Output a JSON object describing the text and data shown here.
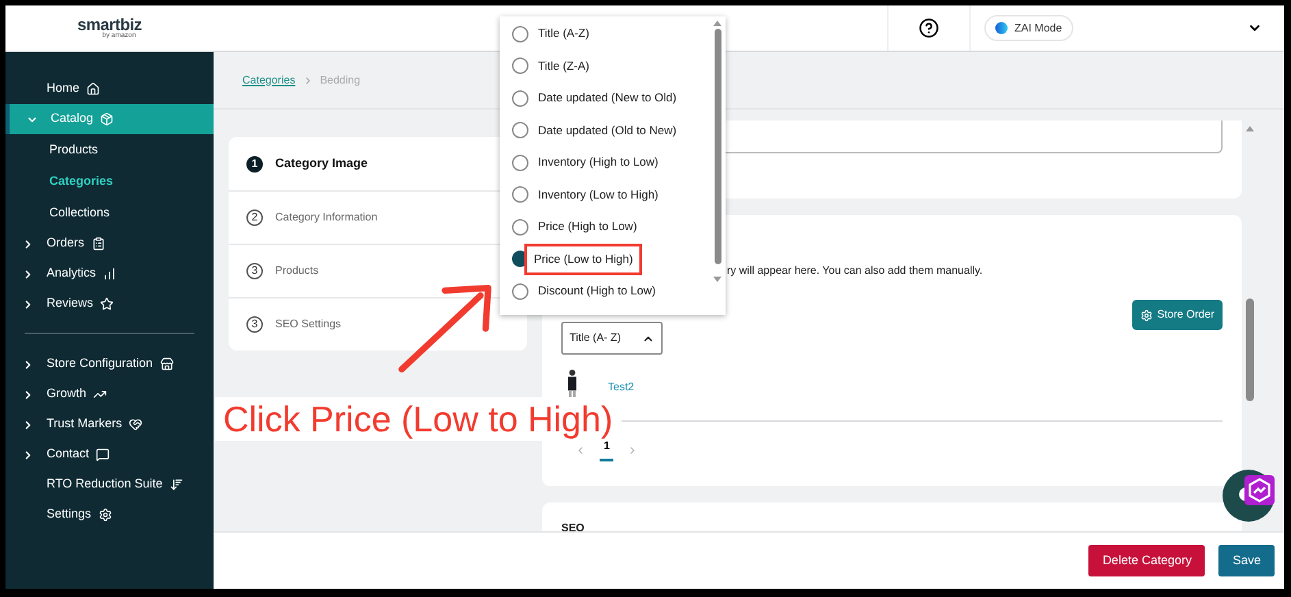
{
  "header": {
    "logo": "smartbiz",
    "logo_sub": "by amazon",
    "mode_label": "ZAI Mode"
  },
  "sidebar": {
    "groups": [
      {
        "items": [
          {
            "label": "Home",
            "expandable": false,
            "selected": false
          },
          {
            "label": "Catalog",
            "expandable": true,
            "expanded": true,
            "selected": true,
            "children": [
              {
                "label": "Products",
                "selected": false
              },
              {
                "label": "Categories",
                "selected": true
              },
              {
                "label": "Collections",
                "selected": false
              }
            ]
          },
          {
            "label": "Orders",
            "expandable": true,
            "expanded": false,
            "selected": false
          },
          {
            "label": "Analytics",
            "expandable": true,
            "expanded": false,
            "selected": false
          },
          {
            "label": "Reviews",
            "expandable": true,
            "expanded": false,
            "selected": false
          }
        ]
      },
      {
        "items": [
          {
            "label": "Store Configuration",
            "expandable": true,
            "expanded": false,
            "selected": false
          },
          {
            "label": "Growth",
            "expandable": true,
            "expanded": false,
            "selected": false
          },
          {
            "label": "Trust Markers",
            "expandable": true,
            "expanded": false,
            "selected": false
          },
          {
            "label": "Contact",
            "expandable": true,
            "expanded": false,
            "selected": false
          },
          {
            "label": "RTO Reduction Suite",
            "expandable": false,
            "selected": false
          },
          {
            "label": "Settings",
            "expandable": false,
            "selected": false
          }
        ]
      }
    ]
  },
  "breadcrumb": [
    {
      "label": "Categories",
      "kind": "link"
    },
    {
      "label": "Bedding",
      "kind": "current"
    }
  ],
  "steps": [
    {
      "number": "1",
      "label": "Category Image",
      "selected": true
    },
    {
      "number": "2",
      "label": "Category Information",
      "selected": false
    },
    {
      "number": "3",
      "label": "Products",
      "selected": false
    },
    {
      "number": "3",
      "label": "SEO Settings",
      "selected": false
    }
  ],
  "products_card": {
    "description": "ry will appear here. You can also add them manually.",
    "store_order_button": "Store Order",
    "sort_select": "Title (A- Z)",
    "products": [
      {
        "name": "Test2"
      }
    ],
    "pages": [
      {
        "label": "1",
        "selected": true
      }
    ]
  },
  "seo_card": {
    "title": "SEO"
  },
  "footer": {
    "buttons": [
      {
        "label": "Delete Category",
        "kind": "danger"
      },
      {
        "label": "Save",
        "kind": "primary"
      }
    ]
  },
  "sort_menu": {
    "options": [
      {
        "label": "Title (A-Z)",
        "selected": false,
        "annotated": false
      },
      {
        "label": "Title (Z-A)",
        "selected": false,
        "annotated": false
      },
      {
        "label": "Date updated (New to Old)",
        "selected": false,
        "annotated": false
      },
      {
        "label": "Date updated (Old to New)",
        "selected": false,
        "annotated": false
      },
      {
        "label": "Inventory (High to Low)",
        "selected": false,
        "annotated": false
      },
      {
        "label": "Inventory (Low to High)",
        "selected": false,
        "annotated": false
      },
      {
        "label": "Price (High to Low)",
        "selected": false,
        "annotated": false
      },
      {
        "label": "Price (Low to High)",
        "selected": true,
        "annotated": true
      },
      {
        "label": "Discount (High to Low)",
        "selected": false,
        "annotated": false
      }
    ]
  },
  "annotation": {
    "text": "Click Price (Low to High)"
  }
}
